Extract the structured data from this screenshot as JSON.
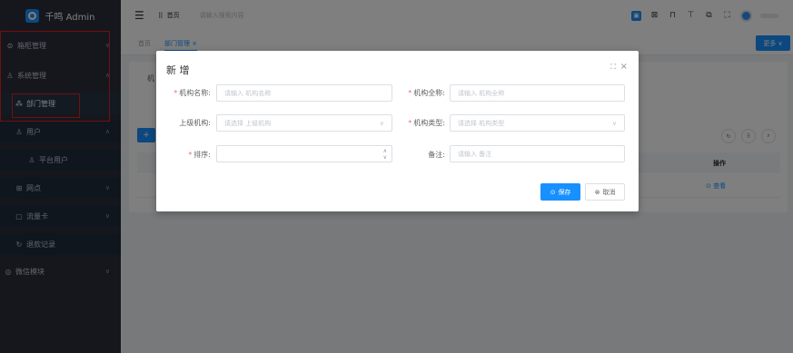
{
  "app": {
    "name": "千鸣 Admin"
  },
  "sidebar": {
    "items": [
      {
        "label": "箱柜管理",
        "icon": "cabinet-icon"
      },
      {
        "label": "系统管理",
        "icon": "system-icon"
      },
      {
        "label": "部门管理",
        "icon": "department-icon"
      },
      {
        "label": "用户",
        "icon": "user-icon"
      },
      {
        "label": "平台用户",
        "icon": "user-icon"
      },
      {
        "label": "网点",
        "icon": "grid-icon"
      },
      {
        "label": "流量卡",
        "icon": "card-icon"
      },
      {
        "label": "退款记录",
        "icon": "refund-icon"
      },
      {
        "label": "微信模块",
        "icon": "wechat-icon"
      }
    ]
  },
  "header": {
    "breadcrumb": "首页",
    "search_placeholder": "请输入搜索内容"
  },
  "tags": {
    "items": [
      {
        "label": "首页"
      },
      {
        "label": "部门管理 ×"
      }
    ],
    "more_label": "更多 ∨"
  },
  "content": {
    "partial_label": "机",
    "column_action": "操作",
    "row_action": "⊙ 查看"
  },
  "dialog": {
    "title": "新 增",
    "fields": {
      "org_name": {
        "label": "机构名称:",
        "placeholder": "请输入 机构名称",
        "required": true
      },
      "org_fullname": {
        "label": "机构全称:",
        "placeholder": "请输入 机构全称",
        "required": true
      },
      "parent_org": {
        "label": "上级机构:",
        "placeholder": "请选择 上级机构",
        "required": false
      },
      "org_type": {
        "label": "机构类型:",
        "placeholder": "请选择 机构类型",
        "required": true
      },
      "sort": {
        "label": "排序:",
        "placeholder": "",
        "required": true
      },
      "remark": {
        "label": "备注:",
        "placeholder": "请输入 备注",
        "required": false
      }
    },
    "save_label": "保存",
    "cancel_label": "取消"
  },
  "colors": {
    "primary": "#1890ff",
    "sidebar_bg": "#2b2f3a",
    "required": "#f56c6c",
    "highlight_box": "#e02020"
  }
}
